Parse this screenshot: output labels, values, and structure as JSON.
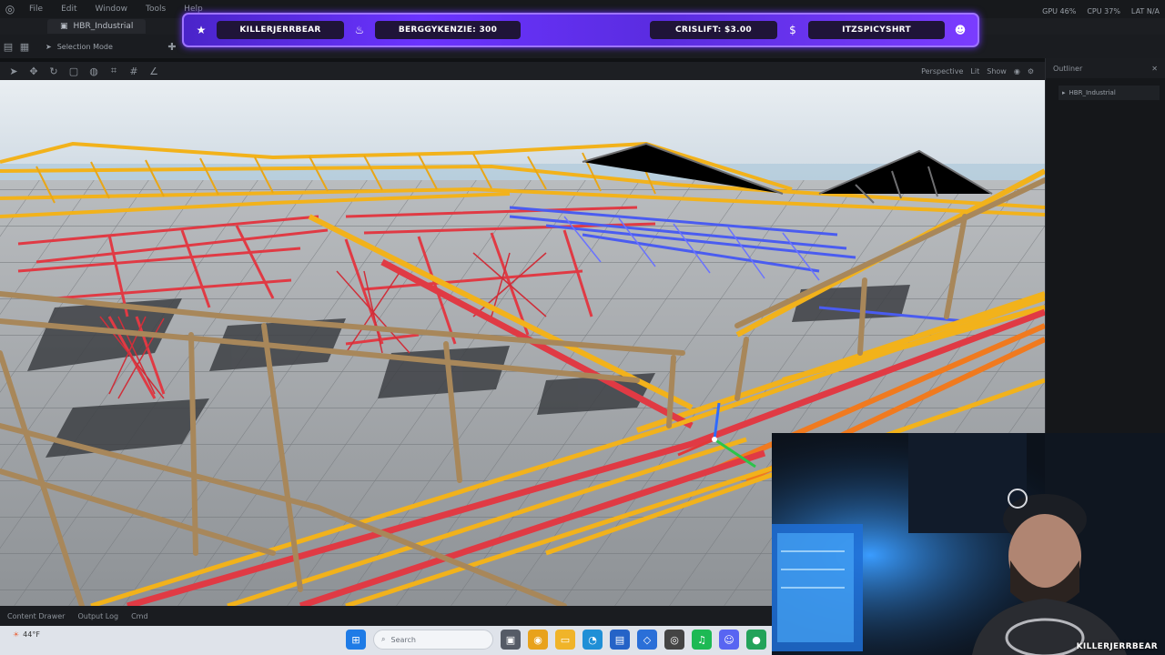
{
  "editor": {
    "menu": [
      "File",
      "Edit",
      "Window",
      "Tools",
      "Help"
    ],
    "doc_tab": "HBR_Industrial",
    "mode_button": "Selection Mode",
    "viewport_modes": [
      "Perspective",
      "Lit"
    ],
    "show_label": "Show",
    "bottom_items": [
      "Content Drawer",
      "Output Log",
      "Cmd"
    ],
    "right_panel_title": "Outliner",
    "right_panel_item": "HBR_Industrial"
  },
  "hud": {
    "gpu": "GPU 46%",
    "cpu": "CPU 37%",
    "lat": "LAT N/A"
  },
  "banner": {
    "segments": [
      {
        "icon": "star-icon",
        "text": "KILLERJERRBEAR"
      },
      {
        "icon": "fire-icon",
        "text": "BERGGYKENZIE: 300"
      },
      {
        "icon": "dollar-icon",
        "text": "CRISLIFT: $3.00"
      },
      {
        "icon": "person-icon",
        "text": "ITZSPICYSHRT"
      }
    ]
  },
  "taskbar": {
    "weather": "44°F",
    "search_placeholder": "Search"
  },
  "webcam": {
    "name": "KILLERJERRBEAR"
  },
  "colors": {
    "banner_purple": "#6b33ff",
    "girder_yellow": "#f2b21b",
    "girder_red": "#e03a44",
    "rail_blue": "#4a5cf0",
    "rust_metal": "#a8875a"
  }
}
